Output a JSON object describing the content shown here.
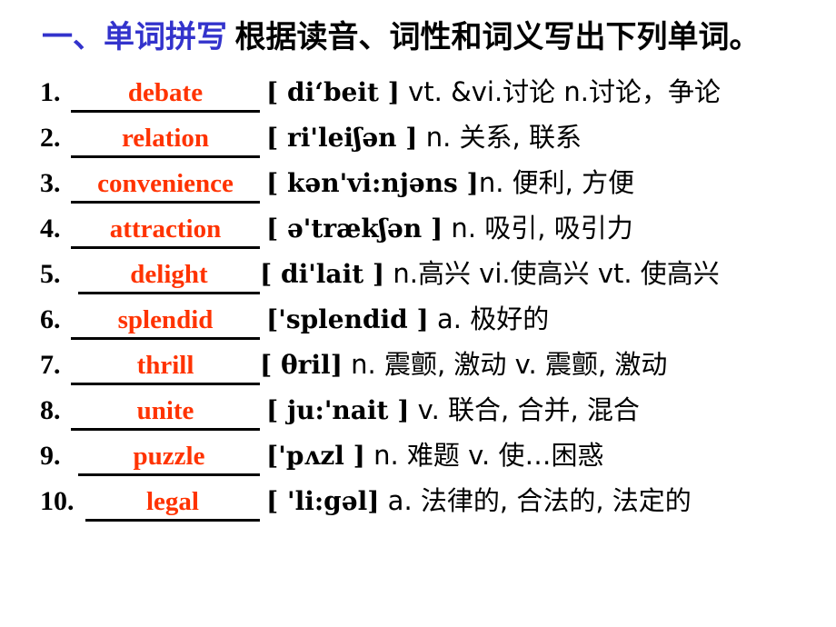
{
  "slide": {
    "background_color": "#ffffff",
    "answer_color": "#ff3300",
    "title_highlight_color": "#3333cc",
    "title": {
      "highlight": "一、单词拼写",
      "rest": " 根据读音、词性和词义写出下列单词。"
    }
  },
  "items": [
    {
      "index": "1.",
      "answer": "debate",
      "phonetic": "[ di‘beit ]",
      "pos_cn": " vt. &vi.讨论 n.讨论，争论"
    },
    {
      "index": "2.",
      "answer": "relation",
      "phonetic": "[ ri'leiʃən ]",
      "pos_cn": "  n. 关系, 联系"
    },
    {
      "index": "3.",
      "answer": "convenience",
      "phonetic": "[ kən'vi:njəns ]",
      "pos_cn": "n. 便利, 方便"
    },
    {
      "index": "4.",
      "answer": "attraction",
      "phonetic": "[ ə'trækʃən ]",
      "pos_cn": "  n. 吸引, 吸引力"
    },
    {
      "index": "5.",
      "answer": "delight",
      "phonetic": "[ di'lait ]",
      "pos_cn": " n.高兴 vi.使高兴 vt. 使高兴"
    },
    {
      "index": "6.",
      "answer": "splendid",
      "phonetic": "['splendid ]",
      "pos_cn": " a. 极好的"
    },
    {
      "index": "7.",
      "answer": "thrill",
      "phonetic": "[ θril]",
      "pos_cn": " n. 震颤, 激动 v. 震颤, 激动"
    },
    {
      "index": "8.",
      "answer": "unite",
      "phonetic": "[ ju:'nait ]",
      "pos_cn": " v. 联合, 合并, 混合"
    },
    {
      "index": "9.",
      "answer": "puzzle",
      "phonetic": "['pʌzl ]",
      "pos_cn": " n. 难题 v. 使…困惑"
    },
    {
      "index": "10.",
      "answer": "legal",
      "phonetic": "[ 'li:gəl]",
      "pos_cn": " a. 法律的, 合法的, 法定的"
    }
  ]
}
